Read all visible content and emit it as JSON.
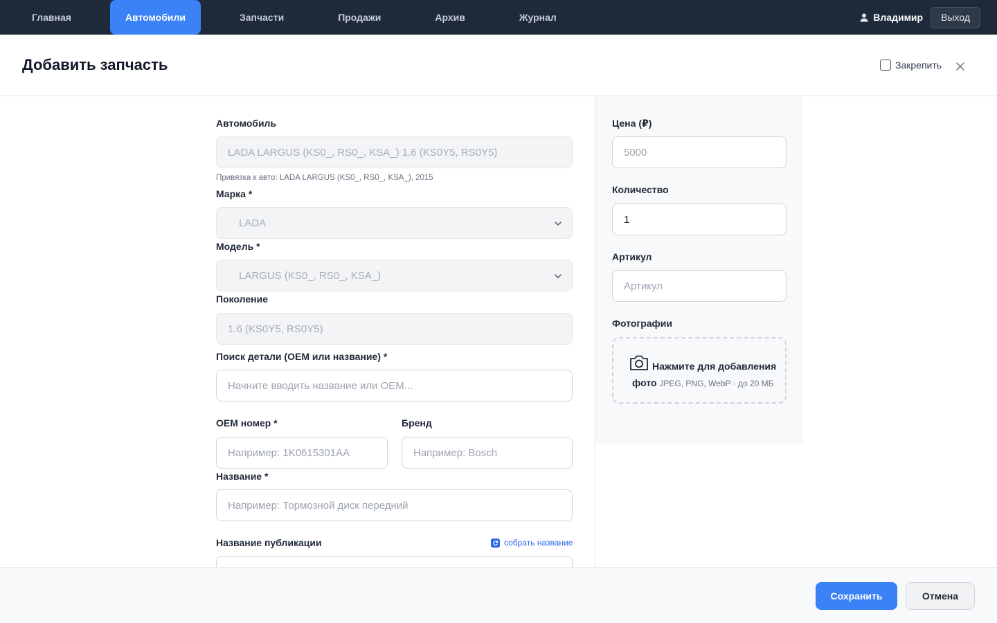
{
  "nav": {
    "tabs": [
      {
        "label": "Главная",
        "active": false
      },
      {
        "label": "Автомобили",
        "active": true
      },
      {
        "label": "Запчасти",
        "active": false
      },
      {
        "label": "Продажи",
        "active": false
      },
      {
        "label": "Архив",
        "active": false
      },
      {
        "label": "Журнал",
        "active": false
      }
    ],
    "user_name": "Владимир",
    "logout_label": "Выход",
    "user_icon": "user-icon"
  },
  "header": {
    "title": "Добавить запчасть",
    "pin_label": "Закрепить",
    "pin_checked": false,
    "close_icon": "close-icon"
  },
  "form": {
    "car": {
      "label": "Автомобиль",
      "value": "LADA LARGUS (KS0_, RS0_, KSA_) 1.6 (KS0Y5, RS0Y5)",
      "hint": "Привязка к авто: LADA LARGUS (KS0_, RS0_, KSA_), 2015"
    },
    "brand": {
      "label": "Марка *",
      "value": "LADA"
    },
    "model": {
      "label": "Модель *",
      "value": "LARGUS (KS0_, RS0_, KSA_)"
    },
    "generation": {
      "label": "Поколение",
      "value": "1.6 (KS0Y5, RS0Y5)"
    },
    "search": {
      "label": "Поиск детали (OEM или название) *",
      "placeholder": "Начните вводить название или OEM..."
    },
    "oem": {
      "label": "OEM номер *",
      "placeholder": "Например: 1K0615301AA"
    },
    "maker": {
      "label": "Бренд",
      "placeholder": "Например: Bosch"
    },
    "name": {
      "label": "Название *",
      "placeholder": "Например: Тормозной диск передний"
    },
    "pub_name": {
      "label": "Название публикации",
      "link": "собрать название",
      "link_icon": "refresh-icon"
    }
  },
  "side": {
    "price": {
      "label": "Цена (₽)",
      "placeholder": "5000"
    },
    "qty": {
      "label": "Количество",
      "value": "1"
    },
    "sku": {
      "label": "Артикул",
      "placeholder": "Артикул"
    },
    "photos": {
      "label": "Фотографии",
      "drop_main": "Нажмите для добавления",
      "drop_main_2": "фото",
      "drop_formats": "JPEG, PNG, WebP · до 20 МБ",
      "icon": "camera-icon"
    }
  },
  "footer": {
    "save_label": "Сохранить",
    "cancel_label": "Отмена"
  },
  "colors": {
    "nav_bg": "#1e2939",
    "accent": "#3b82f6",
    "link": "#2563eb"
  }
}
